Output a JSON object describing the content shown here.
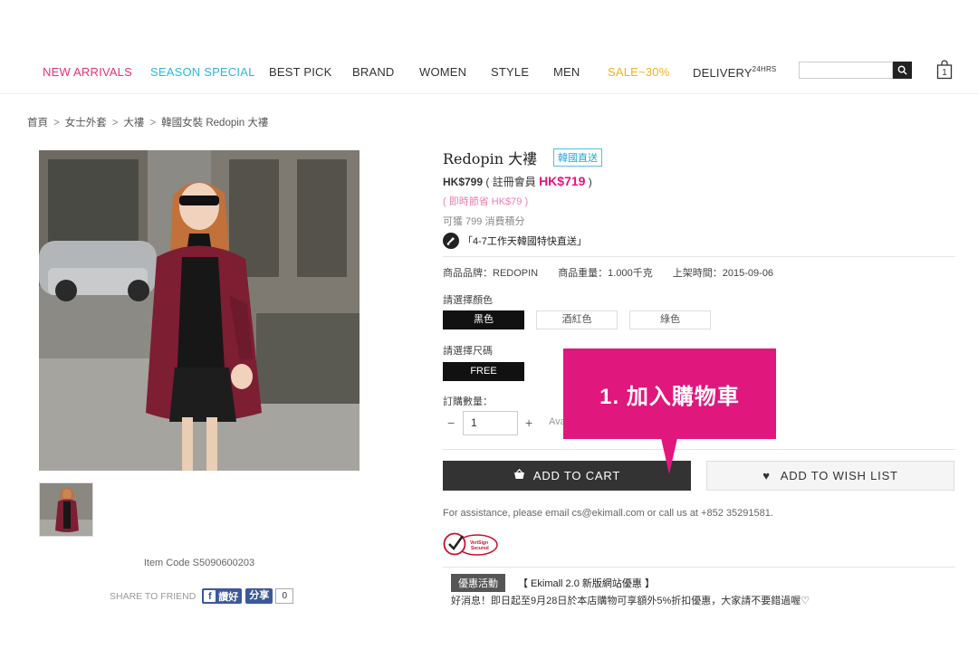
{
  "nav": {
    "items": [
      {
        "label": "NEW ARRIVALS",
        "color": "#e8336f"
      },
      {
        "label": "SEASON SPECIAL",
        "color": "#2bb6e0"
      },
      {
        "label": "BEST PICK",
        "color": "#333333"
      },
      {
        "label": "BRAND",
        "color": "#333333"
      },
      {
        "label": "WOMEN",
        "color": "#333333"
      },
      {
        "label": "STYLE",
        "color": "#333333"
      },
      {
        "label": "MEN",
        "color": "#333333"
      },
      {
        "label": "SALE~30%",
        "color": "#f3b11f"
      },
      {
        "label": "DELIVERY",
        "color": "#333333",
        "sup": "24HRS"
      }
    ],
    "search_icon": "search-icon",
    "cart_icon": "shopping-bag-icon",
    "cart_count": "1"
  },
  "breadcrumb": [
    "首頁",
    "女士外套",
    "大褸",
    "韓國女裝 Redopin 大褸"
  ],
  "product": {
    "item_code": "Item Code S5090600203",
    "share_label": "SHARE TO FRIEND",
    "fb_like": "讚好",
    "fb_share": "分享",
    "share_count": "0",
    "title": "Redopin 大褸",
    "badge": "韓國直送",
    "price": "HK$799",
    "member_prefix": "( 註冊會員",
    "member_price": "HK$719",
    "member_suffix": ")",
    "save_text": "( 即時節省 HK$79 )",
    "points_text": "可獲 799 消費積分",
    "shipping_text": "「4-7工作天韓國特快直送」",
    "brand_text": "商品品牌：REDOPIN",
    "weight_text": "商品重量：1.000千克",
    "date_text": "上架時間：2015-09-06",
    "color_label": "請選擇顏色",
    "colors": [
      "黑色",
      "酒紅色",
      "綠色"
    ],
    "size_label": "請選擇尺碼",
    "sizes": [
      "FREE"
    ],
    "qty_label": "訂購數量：",
    "qty_value": "1",
    "qty_minus": "−",
    "qty_plus": "+",
    "availability": "Ava",
    "add_cart": "ADD TO CART",
    "add_wish": "ADD TO WISH LIST",
    "callout": "1. 加入購物車",
    "assist": "For assistance, please email cs@ekimall.com or call us at +852 35291581.",
    "verisign_lines": [
      "VeriSign",
      "Secured"
    ],
    "promo_tag": "優惠活動",
    "promo_title": "【 Ekimall 2.0 新版網站優惠 】",
    "promo_text": "好消息！即日起至9月28日於本店購物可享額外5%折扣優惠，大家請不要錯過喔♡"
  }
}
